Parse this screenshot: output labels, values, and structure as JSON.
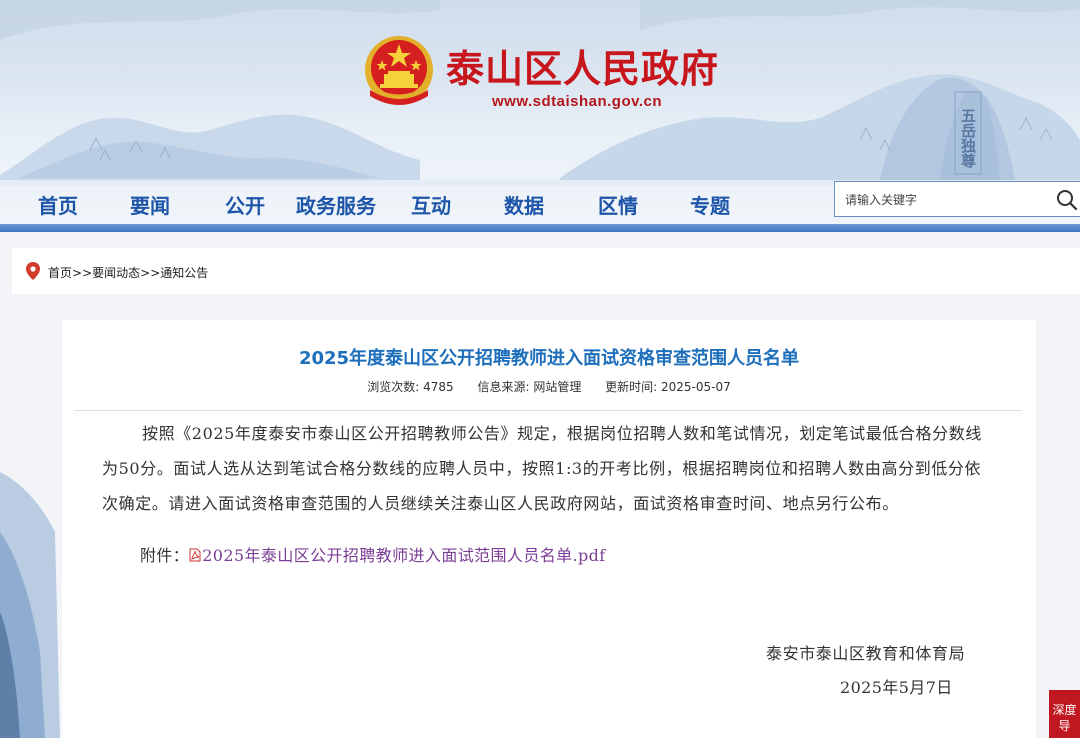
{
  "header": {
    "site_title": "泰山区人民政府",
    "site_url": "www.sdtaishan.gov.cn",
    "rock_inscription": "五岳独尊"
  },
  "nav": {
    "items": [
      "首页",
      "要闻",
      "公开",
      "政务服务",
      "互动",
      "数据",
      "区情",
      "专题"
    ]
  },
  "search": {
    "placeholder": "请输入关键字"
  },
  "breadcrumb": {
    "home": "首页",
    "sep": ">>",
    "level1": "要闻动态",
    "level2": "通知公告"
  },
  "article": {
    "title": "2025年度泰山区公开招聘教师进入面试资格审查范围人员名单",
    "views_label": "浏览次数: 4785",
    "source_label": "信息来源: 网站管理",
    "updated_label": "更新时间: 2025-05-07",
    "body": "按照《2025年度泰安市泰山区公开招聘教师公告》规定，根据岗位招聘人数和笔试情况，划定笔试最低合格分数线为50分。面试人选从达到笔试合格分数线的应聘人员中，按照1:3的开考比例，根据招聘岗位和招聘人数由高分到低分依次确定。请进入面试资格审查范围的人员继续关注泰山区人民政府网站，面试资格审查时间、地点另行公布。",
    "attachment_label": "附件：",
    "attachment_name": "2025年泰山区公开招聘教师进入面试范围人员名单.pdf",
    "signature_org": "泰安市泰山区教育和体育局",
    "signature_date": "2025年5月7日"
  },
  "side_tab": {
    "label": "深度导"
  },
  "colors": {
    "title_red": "#c8161d",
    "nav_blue": "#1d55a8",
    "article_title_blue": "#1e6fbb",
    "link_purple": "#7b3d95",
    "side_tab_red": "#c01820"
  }
}
